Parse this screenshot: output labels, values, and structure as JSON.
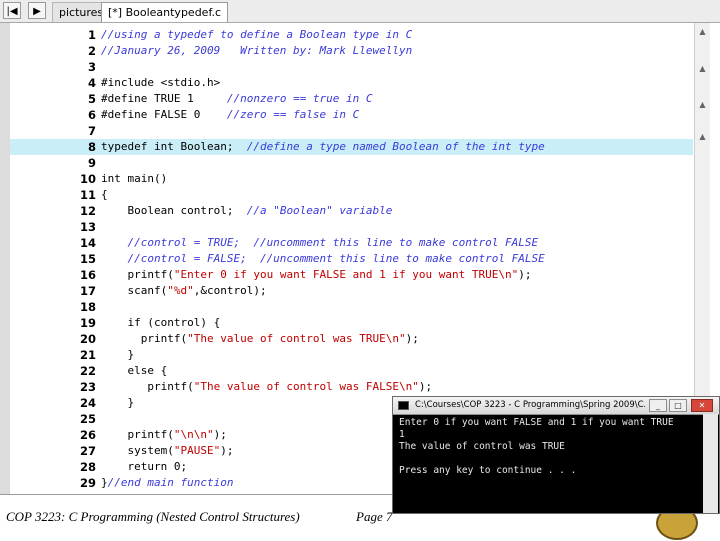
{
  "tabs": {
    "prev_label": "|◀",
    "next_label": "▶",
    "items": [
      {
        "label": "pictures.c",
        "active": false
      },
      {
        "label": "[*] Booleantypedef.c",
        "active": true
      }
    ]
  },
  "editor": {
    "highlight_line": 8,
    "lines": [
      {
        "n": "1",
        "segs": [
          {
            "t": "c",
            "v": "//using a typedef to define a Boolean type in C"
          }
        ]
      },
      {
        "n": "2",
        "segs": [
          {
            "t": "c",
            "v": "//January 26, 2009   Written by: Mark Llewellyn"
          }
        ]
      },
      {
        "n": "3",
        "segs": []
      },
      {
        "n": "4",
        "segs": [
          {
            "t": "n",
            "v": "#include <stdio.h>"
          }
        ]
      },
      {
        "n": "5",
        "segs": [
          {
            "t": "n",
            "v": "#define TRUE 1     "
          },
          {
            "t": "c",
            "v": "//nonzero == true in C"
          }
        ]
      },
      {
        "n": "6",
        "segs": [
          {
            "t": "n",
            "v": "#define FALSE 0    "
          },
          {
            "t": "c",
            "v": "//zero == false in C"
          }
        ]
      },
      {
        "n": "7",
        "segs": []
      },
      {
        "n": "8",
        "segs": [
          {
            "t": "n",
            "v": "typedef int Boolean;  "
          },
          {
            "t": "c",
            "v": "//define a type named Boolean of the int type"
          }
        ]
      },
      {
        "n": "9",
        "segs": []
      },
      {
        "n": "10",
        "segs": [
          {
            "t": "n",
            "v": "int main()"
          }
        ]
      },
      {
        "n": "11",
        "segs": [
          {
            "t": "n",
            "v": "{"
          }
        ]
      },
      {
        "n": "12",
        "segs": [
          {
            "t": "n",
            "v": "    Boolean control;  "
          },
          {
            "t": "c",
            "v": "//a \"Boolean\" variable"
          }
        ]
      },
      {
        "n": "13",
        "segs": []
      },
      {
        "n": "14",
        "segs": [
          {
            "t": "c",
            "v": "    //control = TRUE;  //uncomment this line to make control FALSE"
          }
        ]
      },
      {
        "n": "15",
        "segs": [
          {
            "t": "c",
            "v": "    //control = FALSE;  //uncomment this line to make control FALSE"
          }
        ]
      },
      {
        "n": "16",
        "segs": [
          {
            "t": "n",
            "v": "    printf("
          },
          {
            "t": "s",
            "v": "\"Enter 0 if you want FALSE and 1 if you want TRUE\\n\""
          },
          {
            "t": "n",
            "v": ");"
          }
        ]
      },
      {
        "n": "17",
        "segs": [
          {
            "t": "n",
            "v": "    scanf("
          },
          {
            "t": "s",
            "v": "\"%d\""
          },
          {
            "t": "n",
            "v": ",&control);"
          }
        ]
      },
      {
        "n": "18",
        "segs": []
      },
      {
        "n": "19",
        "segs": [
          {
            "t": "n",
            "v": "    if (control) {"
          }
        ]
      },
      {
        "n": "20",
        "segs": [
          {
            "t": "n",
            "v": "      printf("
          },
          {
            "t": "s",
            "v": "\"The value of control was TRUE\\n\""
          },
          {
            "t": "n",
            "v": ");"
          }
        ]
      },
      {
        "n": "21",
        "segs": [
          {
            "t": "n",
            "v": "    }"
          }
        ]
      },
      {
        "n": "22",
        "segs": [
          {
            "t": "n",
            "v": "    else {"
          }
        ]
      },
      {
        "n": "23",
        "segs": [
          {
            "t": "n",
            "v": "       printf("
          },
          {
            "t": "s",
            "v": "\"The value of control was FALSE\\n\""
          },
          {
            "t": "n",
            "v": ");"
          }
        ]
      },
      {
        "n": "24",
        "segs": [
          {
            "t": "n",
            "v": "    }"
          }
        ]
      },
      {
        "n": "25",
        "segs": []
      },
      {
        "n": "26",
        "segs": [
          {
            "t": "n",
            "v": "    printf("
          },
          {
            "t": "s",
            "v": "\"\\n\\n\""
          },
          {
            "t": "n",
            "v": ");"
          }
        ]
      },
      {
        "n": "27",
        "segs": [
          {
            "t": "n",
            "v": "    system("
          },
          {
            "t": "s",
            "v": "\"PAUSE\""
          },
          {
            "t": "n",
            "v": ");"
          }
        ]
      },
      {
        "n": "28",
        "segs": [
          {
            "t": "n",
            "v": "    return 0;"
          }
        ]
      },
      {
        "n": "29",
        "segs": [
          {
            "t": "n",
            "v": "}"
          },
          {
            "t": "c",
            "v": "//end main function"
          }
        ]
      }
    ]
  },
  "console": {
    "title": "C:\\Courses\\COP 3223 - C Programming\\Spring 2009\\C...",
    "minimize": "_",
    "maximize": "□",
    "close": "✕",
    "lines": [
      "Enter 0 if you want FALSE and 1 if you want TRUE",
      "1",
      "The value of control was TRUE",
      "",
      "Press any key to continue . . ."
    ]
  },
  "footer": {
    "course": "COP 3223: C Programming (Nested Control Structures)",
    "page": "Page 7"
  },
  "colors": {
    "comment": "#3a3ad8",
    "string": "#c00000",
    "highlight": "#c9eef7"
  }
}
